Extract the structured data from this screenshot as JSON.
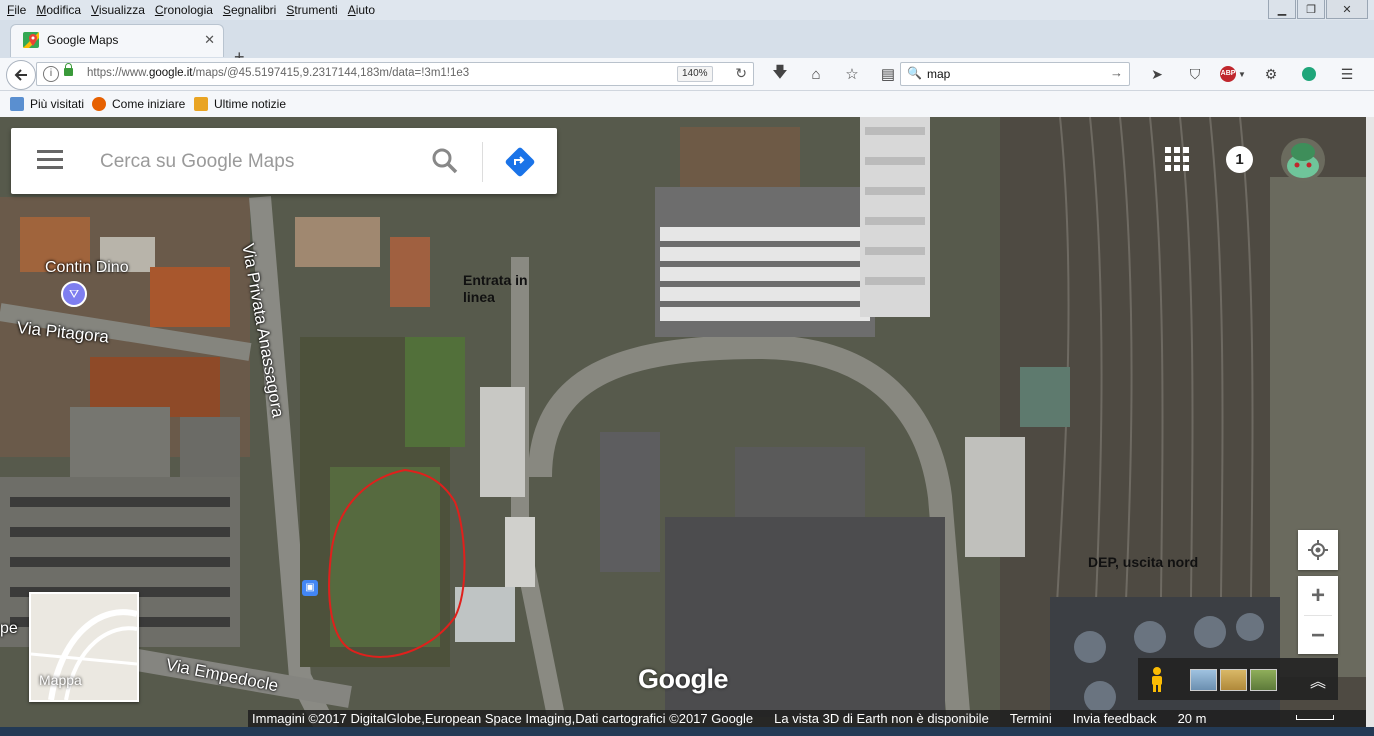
{
  "menubar": {
    "items": [
      "File",
      "Modifica",
      "Visualizza",
      "Cronologia",
      "Segnalibri",
      "Strumenti",
      "Aiuto"
    ],
    "window_controls": [
      "minimize",
      "restore",
      "close"
    ]
  },
  "tab": {
    "title": "Google Maps",
    "favicon": "google-maps-icon"
  },
  "urlbar": {
    "url_prefix": "https://www.",
    "url_host": "google.it",
    "url_path": "/maps/@45.5197415,9.2317144,183m/data=!3m1!1e3",
    "zoom": "140%"
  },
  "searchbar": {
    "value": "map"
  },
  "bookmarks": [
    {
      "label": "Più visitati",
      "icon": "bookmark-icon"
    },
    {
      "label": "Come iniziare",
      "icon": "firefox-icon"
    },
    {
      "label": "Ultime notizie",
      "icon": "rss-icon"
    }
  ],
  "maps": {
    "search_placeholder": "Cerca su Google Maps",
    "notifications_count": "1",
    "place_labels": {
      "contin_dino": "Contin Dino",
      "via_pitagora": "Via Pitagora",
      "via_privata_anassagora": "Via Privata Anassagora",
      "via_empedocle": "Via Empedocle",
      "pe_fragment": "pe"
    },
    "annotations": {
      "entrata": "Entrata in linea",
      "dep": "DEP, uscita nord"
    },
    "minimap_label": "Mappa",
    "logo": "Google",
    "footer": {
      "imagery": "Immagini ©2017 DigitalGlobe,European Space Imaging,Dati cartografici ©2017 Google",
      "earth_3d": "La vista 3D di Earth non è disponibile",
      "terms": "Termini",
      "feedback": "Invia feedback",
      "scale": "20 m"
    },
    "colors": {
      "accent": "#1a73e8",
      "annotation_circle": "#e0201c"
    }
  }
}
